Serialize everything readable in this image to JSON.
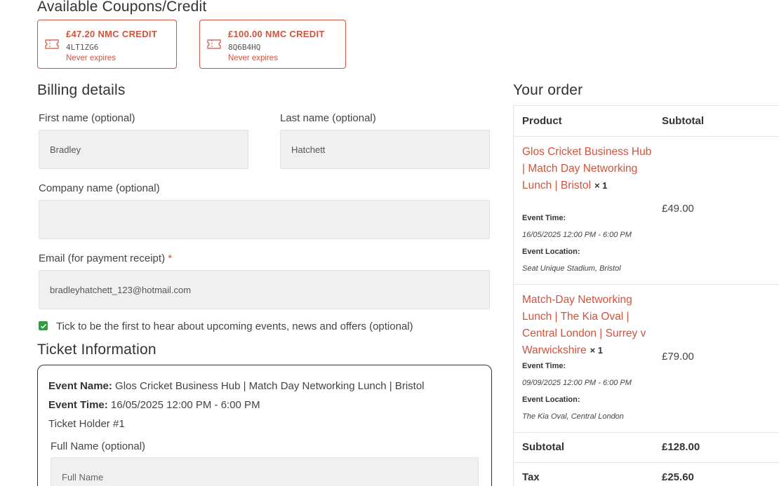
{
  "coupons": {
    "heading": "Available Coupons/Credit",
    "items": [
      {
        "amount": "£47.20 NMC CREDIT",
        "code": "4LT1ZG6",
        "expiry": "Never expires"
      },
      {
        "amount": "£100.00 NMC CREDIT",
        "code": "8Q6B4HQ",
        "expiry": "Never expires"
      }
    ]
  },
  "billing": {
    "heading": "Billing details",
    "first_name": {
      "label": "First name (optional)",
      "value": "Bradley"
    },
    "last_name": {
      "label": "Last name (optional)",
      "value": "Hatchett"
    },
    "company": {
      "label": "Company name (optional)",
      "value": ""
    },
    "email": {
      "label": "Email (for payment receipt)",
      "required_mark": "*",
      "value": "bradleyhatchett_123@hotmail.com"
    },
    "newsletter": {
      "label": "Tick to be the first to hear about upcoming events, news and offers (optional)",
      "checked": true
    }
  },
  "ticket": {
    "heading": "Ticket Information",
    "event_name_label": "Event Name:",
    "event_name": "Glos Cricket Business Hub | Match Day Networking Lunch | Bristol",
    "event_time_label": "Event Time:",
    "event_time": "16/05/2025 12:00 PM - 6:00 PM",
    "holder": "Ticket Holder #1",
    "full_name_label": "Full Name (optional)",
    "full_name_placeholder": "Full Name"
  },
  "order": {
    "heading": "Your order",
    "col_product": "Product",
    "col_subtotal": "Subtotal",
    "items": [
      {
        "title": "Glos Cricket Business Hub | Match Day Networking Lunch | Bristol",
        "qty": "× 1",
        "time_label": "Event Time:",
        "time": "16/05/2025 12:00 PM - 6:00 PM",
        "location_label": "Event Location:",
        "location": "Seat Unique Stadium, Bristol",
        "price": "£49.00"
      },
      {
        "title": "Match-Day Networking Lunch | The Kia Oval | Central London | Surrey v Warwickshire",
        "qty": "× 1",
        "time_label": "Event Time:",
        "time": "09/09/2025 12:00 PM - 6:00 PM",
        "location_label": "Event Location:",
        "location": "The Kia Oval, Central London",
        "price": "£79.00"
      }
    ],
    "subtotal_label": "Subtotal",
    "subtotal": "£128.00",
    "tax_label": "Tax",
    "tax": "£25.60"
  },
  "colors": {
    "accent": "#d0533b",
    "checkbox": "#2f9e3c",
    "input_bg": "#f0f0f0"
  }
}
